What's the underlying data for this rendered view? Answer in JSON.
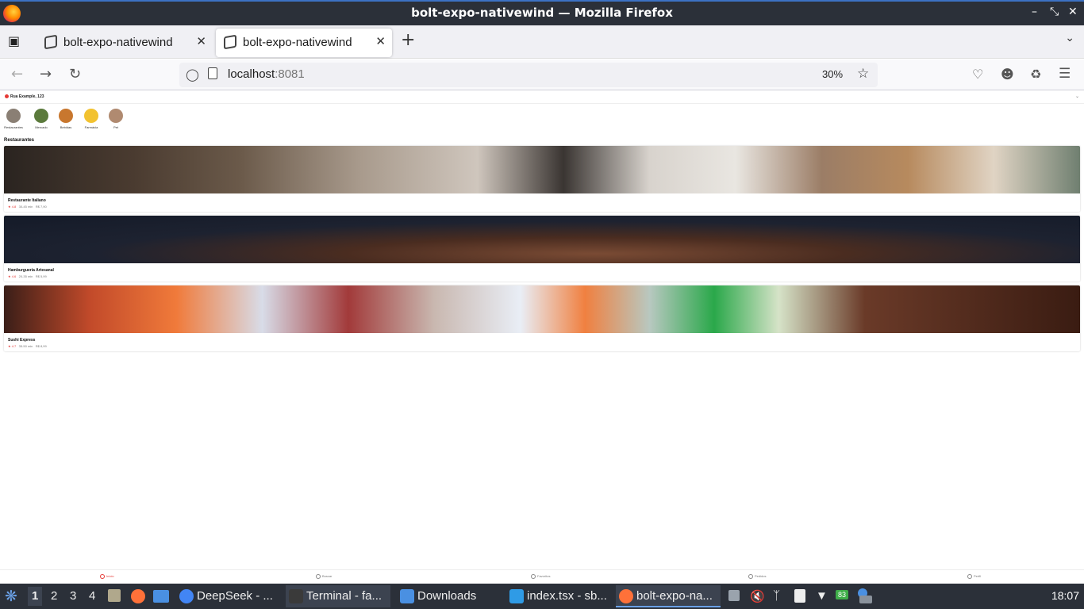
{
  "window": {
    "title": "bolt-expo-nativewind — Mozilla Firefox"
  },
  "tabs": [
    {
      "label": "bolt-expo-nativewind",
      "active": false
    },
    {
      "label": "bolt-expo-nativewind",
      "active": true
    }
  ],
  "navbar": {
    "url_host": "localhost",
    "url_port": ":8081",
    "zoom": "30%"
  },
  "app": {
    "address": "Rua Example, 123",
    "categories": [
      {
        "label": "Restaurantes",
        "color": "#8a7f74"
      },
      {
        "label": "Mercado",
        "color": "#5b7a3c"
      },
      {
        "label": "Bebidas",
        "color": "#c8772e"
      },
      {
        "label": "Farmácia",
        "color": "#f2c230"
      },
      {
        "label": "Pet",
        "color": "#b08a70"
      }
    ],
    "section_title": "Restaurantes",
    "restaurants": [
      {
        "name": "Restaurante Italiano",
        "rating": "★ 4.8",
        "time": "30-45 min",
        "fee": "R$ 7,90"
      },
      {
        "name": "Hamburgueria Artesanal",
        "rating": "★ 4.6",
        "time": "20-35 min",
        "fee": "R$ 5,99"
      },
      {
        "name": "Sushi Express",
        "rating": "★ 4.7",
        "time": "35-50 min",
        "fee": "R$ 8,99"
      }
    ],
    "bottom_nav": [
      {
        "label": "Início",
        "active": true
      },
      {
        "label": "Buscar",
        "active": false
      },
      {
        "label": "Favoritos",
        "active": false
      },
      {
        "label": "Pedidos",
        "active": false
      },
      {
        "label": "Perfil",
        "active": false
      }
    ]
  },
  "taskbar": {
    "workspaces": [
      "1",
      "2",
      "3",
      "4"
    ],
    "apps": [
      {
        "label": "DeepSeek - ...",
        "icon": "chrome-icon",
        "color": "#4285f4"
      },
      {
        "label": "Terminal - fa...",
        "icon": "terminal-icon",
        "color": "#3a3a3a"
      },
      {
        "label": "Downloads",
        "icon": "folder-icon",
        "color": "#4a90e2"
      },
      {
        "label": "index.tsx - sb...",
        "icon": "vscode-icon",
        "color": "#2f9be6"
      },
      {
        "label": "bolt-expo-na...",
        "icon": "firefox-icon",
        "color": "#ff7139"
      }
    ],
    "battery": "83",
    "clock": "18:07"
  }
}
